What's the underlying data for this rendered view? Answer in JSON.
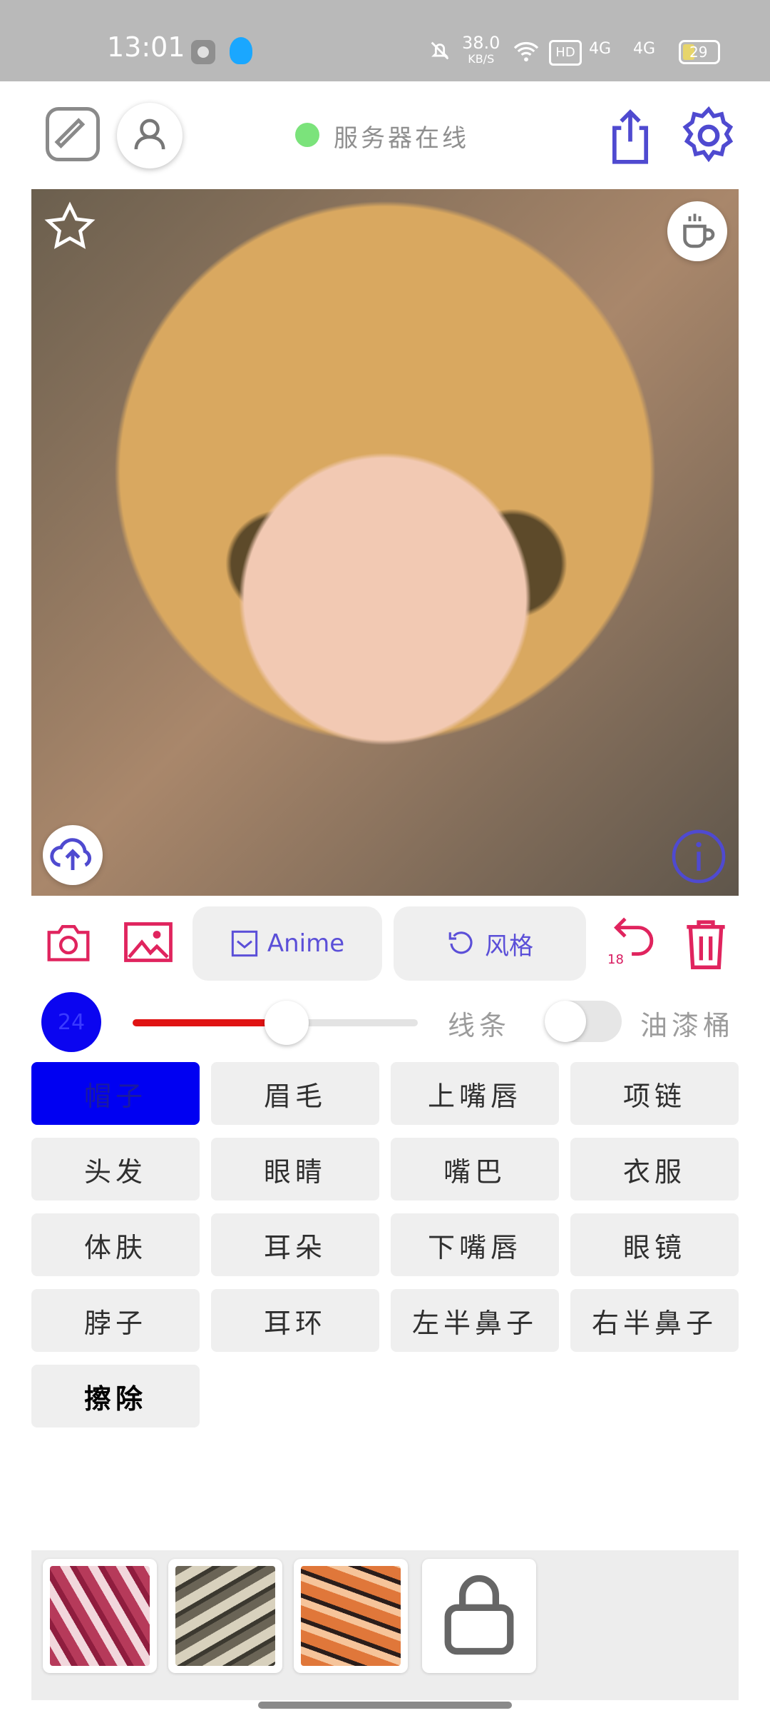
{
  "status_bar": {
    "time": "13:01",
    "net_speed_value": "38.0",
    "net_speed_unit": "KB/S",
    "hd_label": "HD",
    "signal_1": "4G",
    "signal_2": "4G",
    "battery": "29"
  },
  "header": {
    "server_status": "服务器在线",
    "status_color": "#7be37b",
    "accent": "#4f4ad0"
  },
  "toolbar": {
    "mode_label": "Anime",
    "style_label": "风格",
    "undo_count": "18"
  },
  "brush": {
    "size": "24",
    "slider_fraction": 0.54,
    "lines_label": "线条",
    "paint_bucket_label": "油漆桶"
  },
  "categories": [
    {
      "label": "帽子"
    },
    {
      "label": "眉毛"
    },
    {
      "label": "上嘴唇"
    },
    {
      "label": "项链"
    },
    {
      "label": "头发"
    },
    {
      "label": "眼睛"
    },
    {
      "label": "嘴巴"
    },
    {
      "label": "衣服"
    },
    {
      "label": "体肤"
    },
    {
      "label": "耳朵"
    },
    {
      "label": "下嘴唇"
    },
    {
      "label": "眼镜"
    },
    {
      "label": "脖子"
    },
    {
      "label": "耳环"
    },
    {
      "label": "左半鼻子"
    },
    {
      "label": "右半鼻子"
    },
    {
      "label": "擦除"
    }
  ],
  "icons": [
    "edit-icon",
    "user-icon",
    "share-icon",
    "settings-icon",
    "star-icon",
    "coffee-icon",
    "upload-cloud-icon",
    "info-icon",
    "camera-icon",
    "image-icon",
    "undo-icon",
    "trash-icon",
    "lock-icon"
  ],
  "colors": {
    "active_chip": "#0000f2",
    "pink_icons": "#e0245e",
    "slider_red": "#e01313"
  }
}
